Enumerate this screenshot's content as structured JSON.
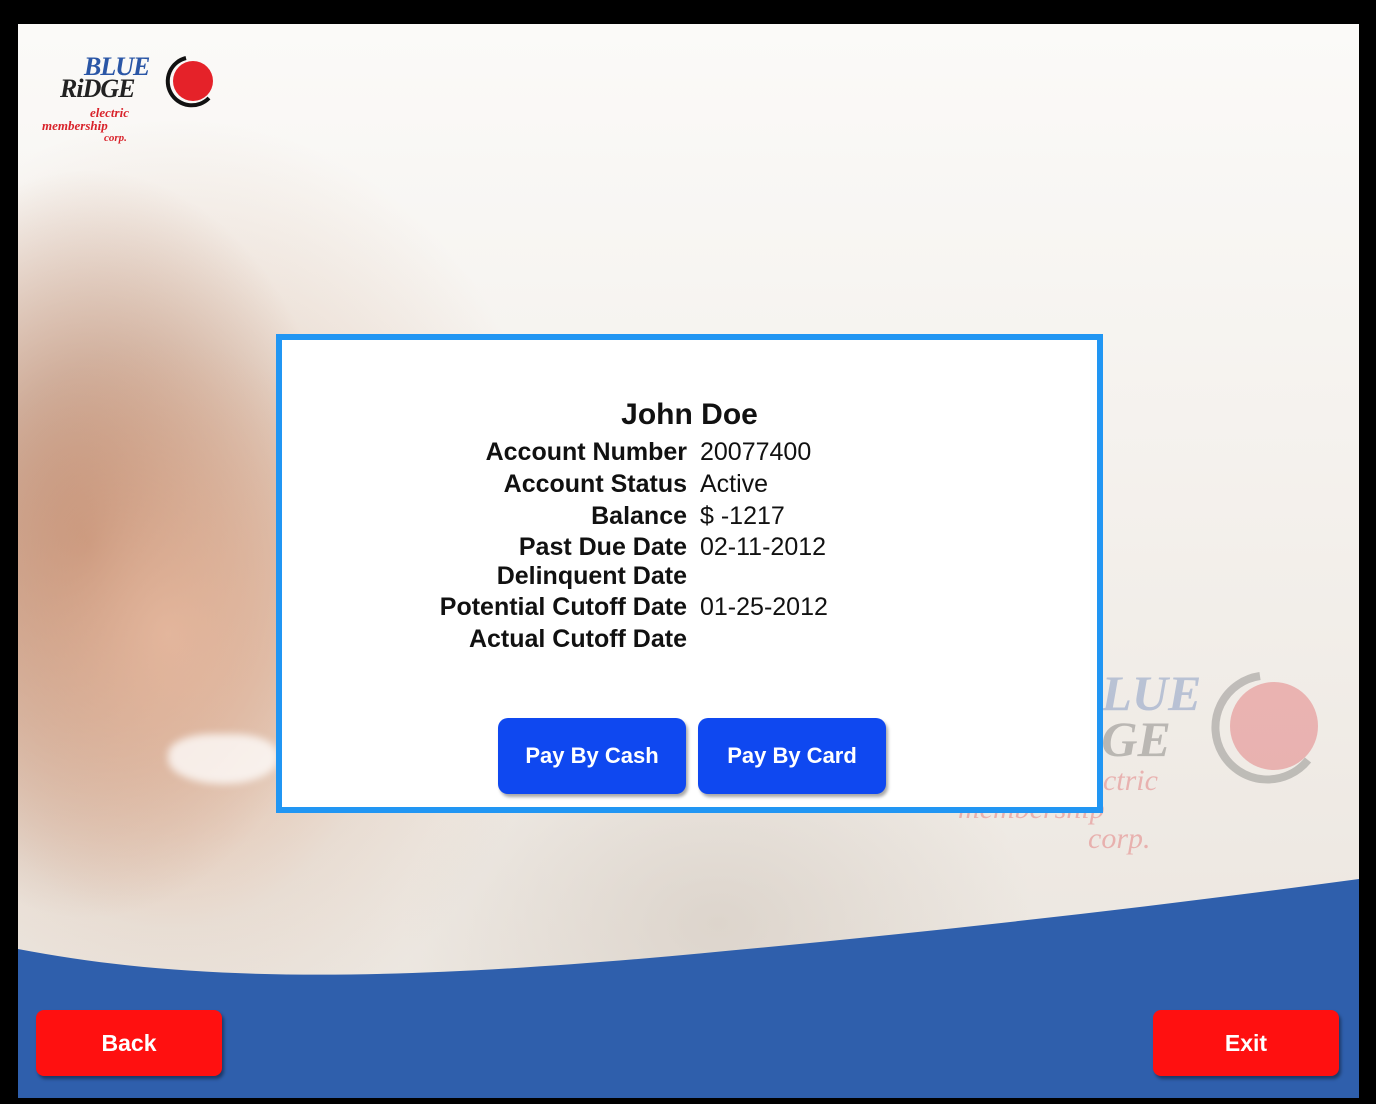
{
  "brand": {
    "logo_line1": "BLUE",
    "logo_line2": "RiDGE",
    "logo_line3": "electric",
    "logo_line4": "membership",
    "logo_line5": "corp.",
    "colors": {
      "brand_blue": "#2a56a6",
      "brand_red": "#d9222a",
      "dialog_border": "#2196f3",
      "pay_button": "#0f48f0",
      "nav_button": "#ff1010",
      "footer_wave": "#2f5fac"
    }
  },
  "watermark": {
    "line1": "BLUE",
    "line2": "RiDGE",
    "line3": "electric",
    "line4": "membership",
    "line5": "corp."
  },
  "account": {
    "name": "John Doe",
    "rows": [
      {
        "label": "Account Number",
        "value": "20077400"
      },
      {
        "label": "Account Status",
        "value": "Active"
      },
      {
        "label": "Balance",
        "value": "$ -1217"
      },
      {
        "label": "Past Due Date",
        "value": "02-11-2012"
      },
      {
        "label": "Delinquent Date",
        "value": ""
      },
      {
        "label": "Potential Cutoff Date",
        "value": "01-25-2012"
      },
      {
        "label": "Actual Cutoff Date",
        "value": ""
      }
    ]
  },
  "actions": {
    "pay_cash": "Pay By Cash",
    "pay_card": "Pay By Card"
  },
  "nav": {
    "back": "Back",
    "exit": "Exit"
  }
}
